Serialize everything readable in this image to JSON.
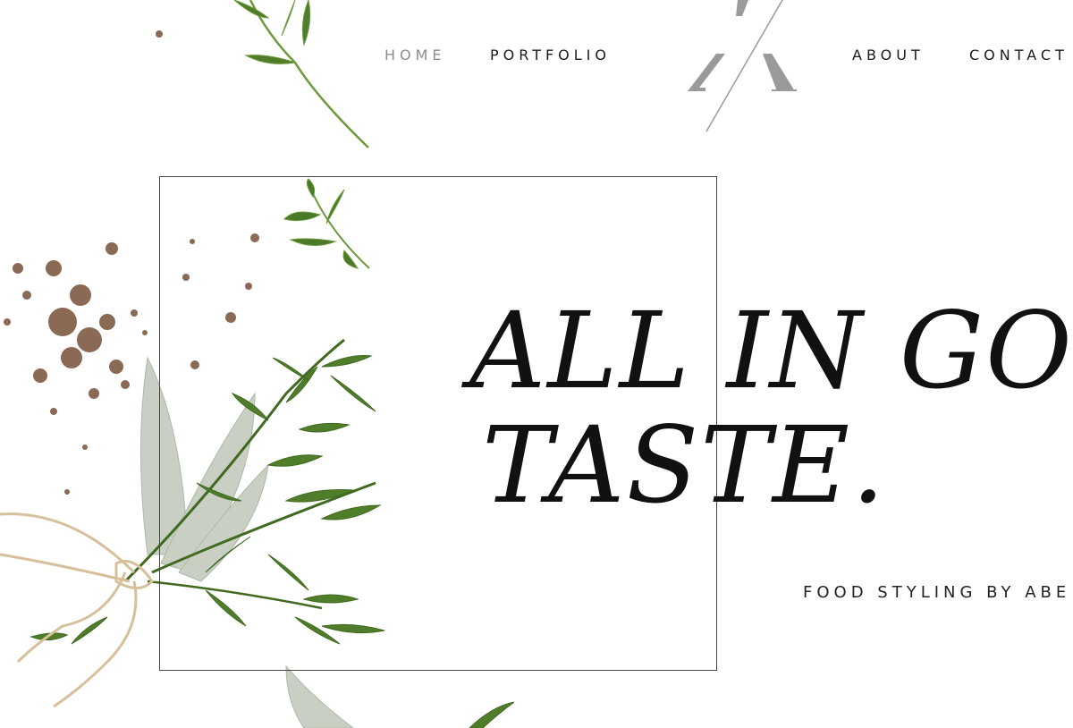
{
  "nav": {
    "home": "HOME",
    "portfolio": "PORTFOLIO",
    "about": "ABOUT",
    "contact": "CONTACT"
  },
  "hero": {
    "headline_line1": "ALL IN GO",
    "headline_line2": "TASTE.",
    "tagline": "FOOD STYLING BY ABE"
  },
  "colors": {
    "nav_active": "#8c8c8c",
    "text": "#111111",
    "logo": "#999999",
    "herb_green": "#4f7d2a",
    "sage": "#c5cdbf",
    "twine": "#d8c3a0",
    "soil": "#8a6a55"
  }
}
